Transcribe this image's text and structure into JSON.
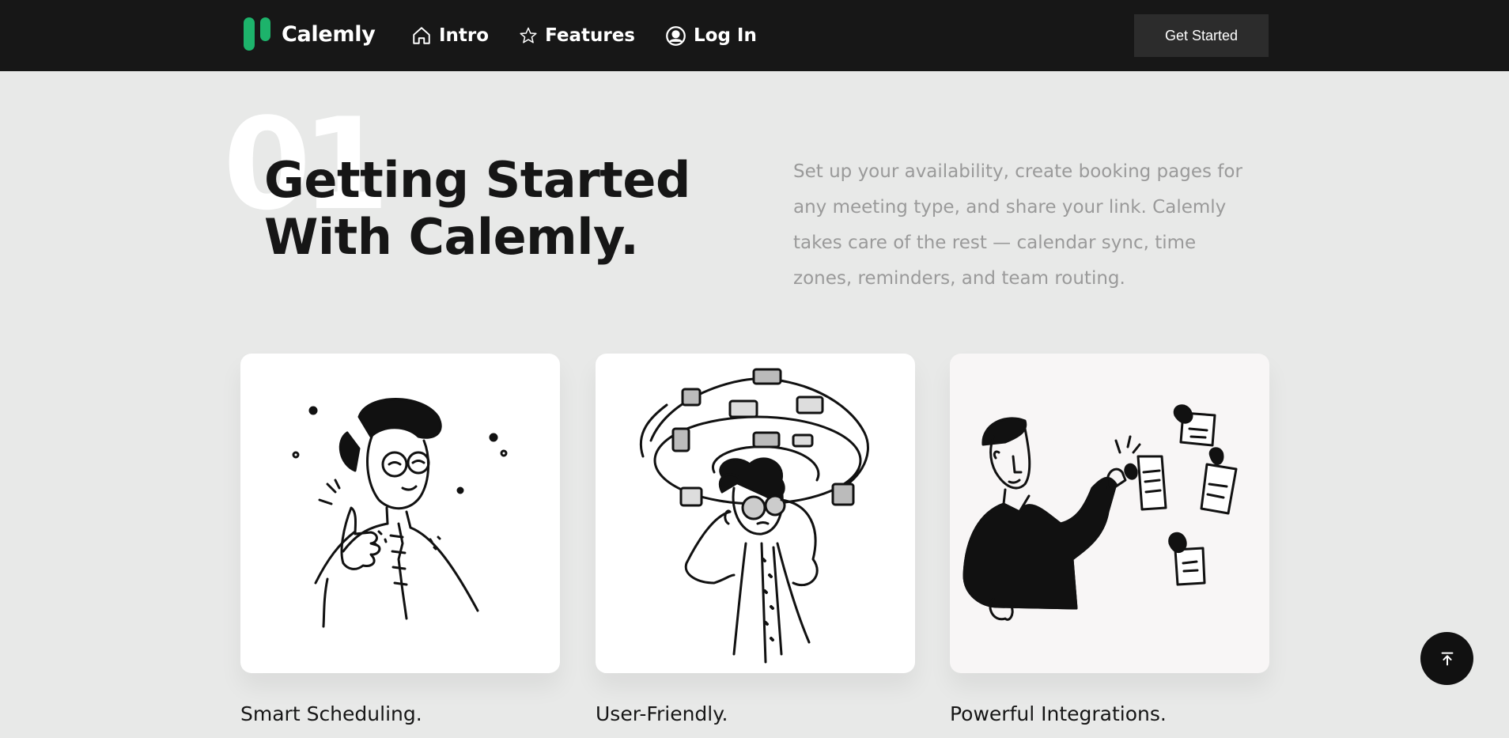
{
  "brand": {
    "name": "Calemly",
    "color": "#1db36b"
  },
  "nav": {
    "items": [
      {
        "label": "Intro",
        "icon": "home-icon"
      },
      {
        "label": "Features",
        "icon": "star-icon"
      },
      {
        "label": "Log In",
        "icon": "user-circle-icon"
      }
    ],
    "cta_label": "Get Started"
  },
  "hero": {
    "number": "01",
    "title_line1": "Getting Started",
    "title_line2": "With Calemly.",
    "description": "Set up your availability, create booking pages for any meeting type, and share your link. Calemly takes care of the rest — calendar sync, time zones, reminders, and team routing."
  },
  "features": [
    {
      "title": "Smart Scheduling.",
      "illustration": "thumbs-up-person-illustration"
    },
    {
      "title": "User-Friendly.",
      "illustration": "thinking-person-illustration"
    },
    {
      "title": "Powerful Integrations.",
      "illustration": "person-pinning-notes-illustration"
    }
  ],
  "scroll_top_icon": "arrow-up-to-top-icon"
}
